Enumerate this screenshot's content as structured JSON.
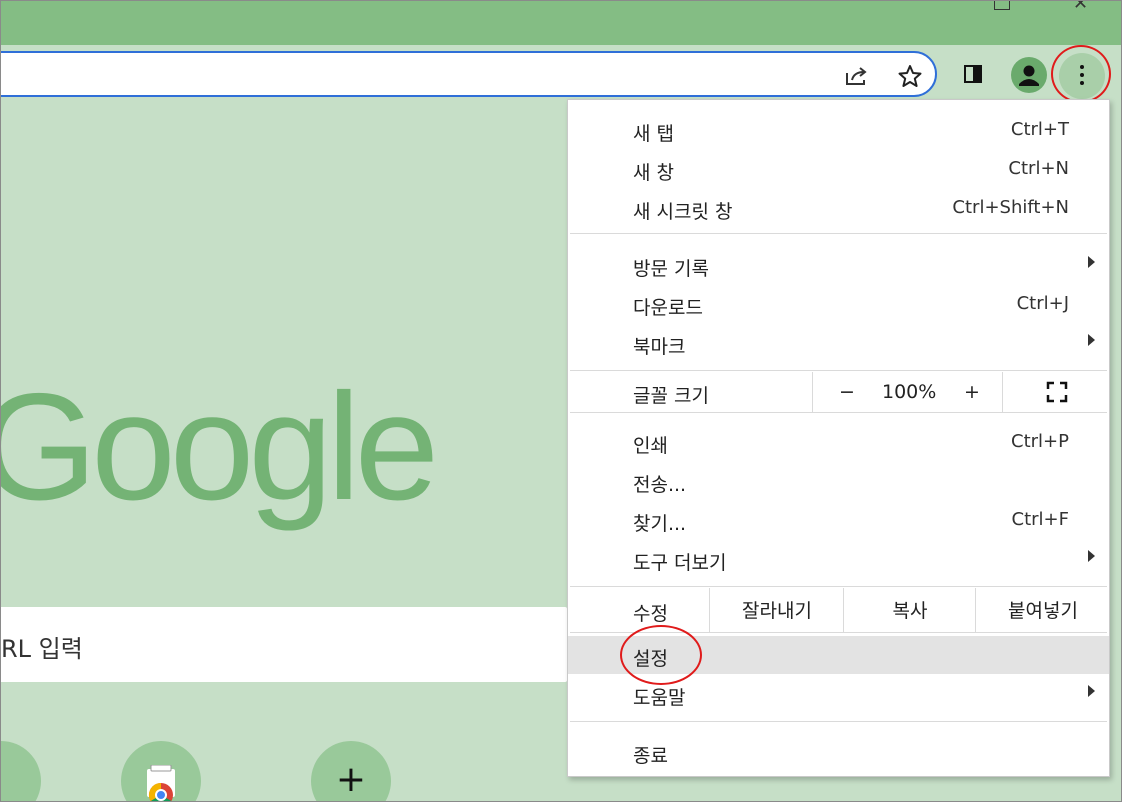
{
  "browser": {
    "window_controls": [
      "restore",
      "close"
    ],
    "toolbar": {
      "icons": [
        "share-icon",
        "star-icon",
        "reading-list-icon",
        "profile-icon",
        "menu-icon"
      ]
    }
  },
  "page": {
    "logo_text": "Google",
    "search_placeholder": "RL 입력",
    "shortcuts": [
      {
        "icon": "partial-shortcut"
      },
      {
        "icon": "chrome-web-store-icon"
      },
      {
        "label": "+",
        "icon": "add-icon"
      }
    ]
  },
  "menu": {
    "group1": [
      {
        "label": "새 탭",
        "shortcut": "Ctrl+T"
      },
      {
        "label": "새 창",
        "shortcut": "Ctrl+N"
      },
      {
        "label": "새 시크릿 창",
        "shortcut": "Ctrl+Shift+N"
      }
    ],
    "group2": [
      {
        "label": "방문 기록",
        "submenu": true
      },
      {
        "label": "다운로드",
        "shortcut": "Ctrl+J"
      },
      {
        "label": "북마크",
        "submenu": true
      }
    ],
    "zoom": {
      "label": "글꼴 크기",
      "minus": "−",
      "value": "100%",
      "plus": "+",
      "fullscreen_icon": "fullscreen-icon"
    },
    "group3": [
      {
        "label": "인쇄",
        "shortcut": "Ctrl+P"
      },
      {
        "label": "전송..."
      },
      {
        "label": "찾기...",
        "shortcut": "Ctrl+F"
      },
      {
        "label": "도구 더보기",
        "submenu": true
      }
    ],
    "edit": {
      "label": "수정",
      "cut": "잘라내기",
      "copy": "복사",
      "paste": "붙여넣기"
    },
    "group4": [
      {
        "label": "설정",
        "highlighted": true
      },
      {
        "label": "도움말",
        "submenu": true
      }
    ],
    "exit": {
      "label": "종료"
    }
  },
  "colors": {
    "frame": "#84bd84",
    "page_bg": "#c6dfc7",
    "accent": "#2f6fd8",
    "annotation": "#e01b1b",
    "logo": "#74b375"
  }
}
